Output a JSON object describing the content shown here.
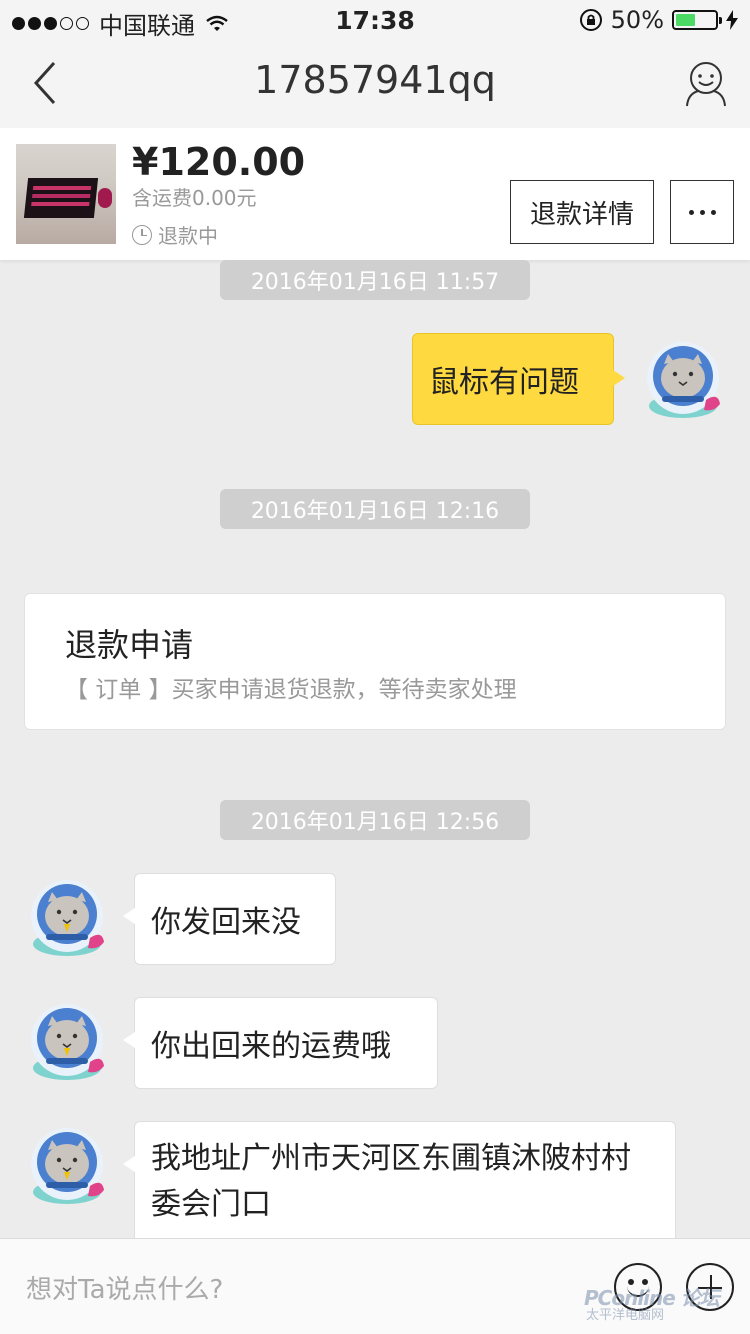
{
  "status_bar": {
    "carrier": "中国联通",
    "time": "17:38",
    "battery": "50%",
    "battery_level": 0.5,
    "signal_bars": 3
  },
  "nav": {
    "title": "17857941qq",
    "back_icon": "chevron-left-icon",
    "profile_icon": "user-face-icon"
  },
  "order": {
    "price": "¥120.00",
    "shipping": "含运费0.00元",
    "status": "退款中",
    "detail_button": "退款详情",
    "more_icon": "more-dots-icon"
  },
  "messages": [
    {
      "timestamp": "2016年01月16日 11:57"
    },
    {
      "from": "me",
      "text": "鼠标有问题"
    },
    {
      "timestamp": "2016年01月16日 12:16"
    },
    {
      "system": true,
      "title": "退款申请",
      "desc": "【 订单 】买家申请退货退款，等待卖家处理"
    },
    {
      "timestamp": "2016年01月16日 12:56"
    },
    {
      "from": "seller",
      "text": "你发回来没"
    },
    {
      "from": "seller",
      "text": "你出回来的运费哦"
    },
    {
      "from": "seller",
      "text": "我地址广州市天河区东圃镇沐陂村村委会门口"
    }
  ],
  "input": {
    "placeholder": "想对Ta说点什么?",
    "emoji_icon": "smiley-icon",
    "plus_icon": "plus-circle-icon"
  },
  "watermark": {
    "brand": "PConline",
    "sub": "太平洋电脑网",
    "tag": "论坛"
  },
  "colors": {
    "my_bubble": "#ffd940",
    "background": "#ececec",
    "timestamp_pill": "#cfcfcf"
  }
}
